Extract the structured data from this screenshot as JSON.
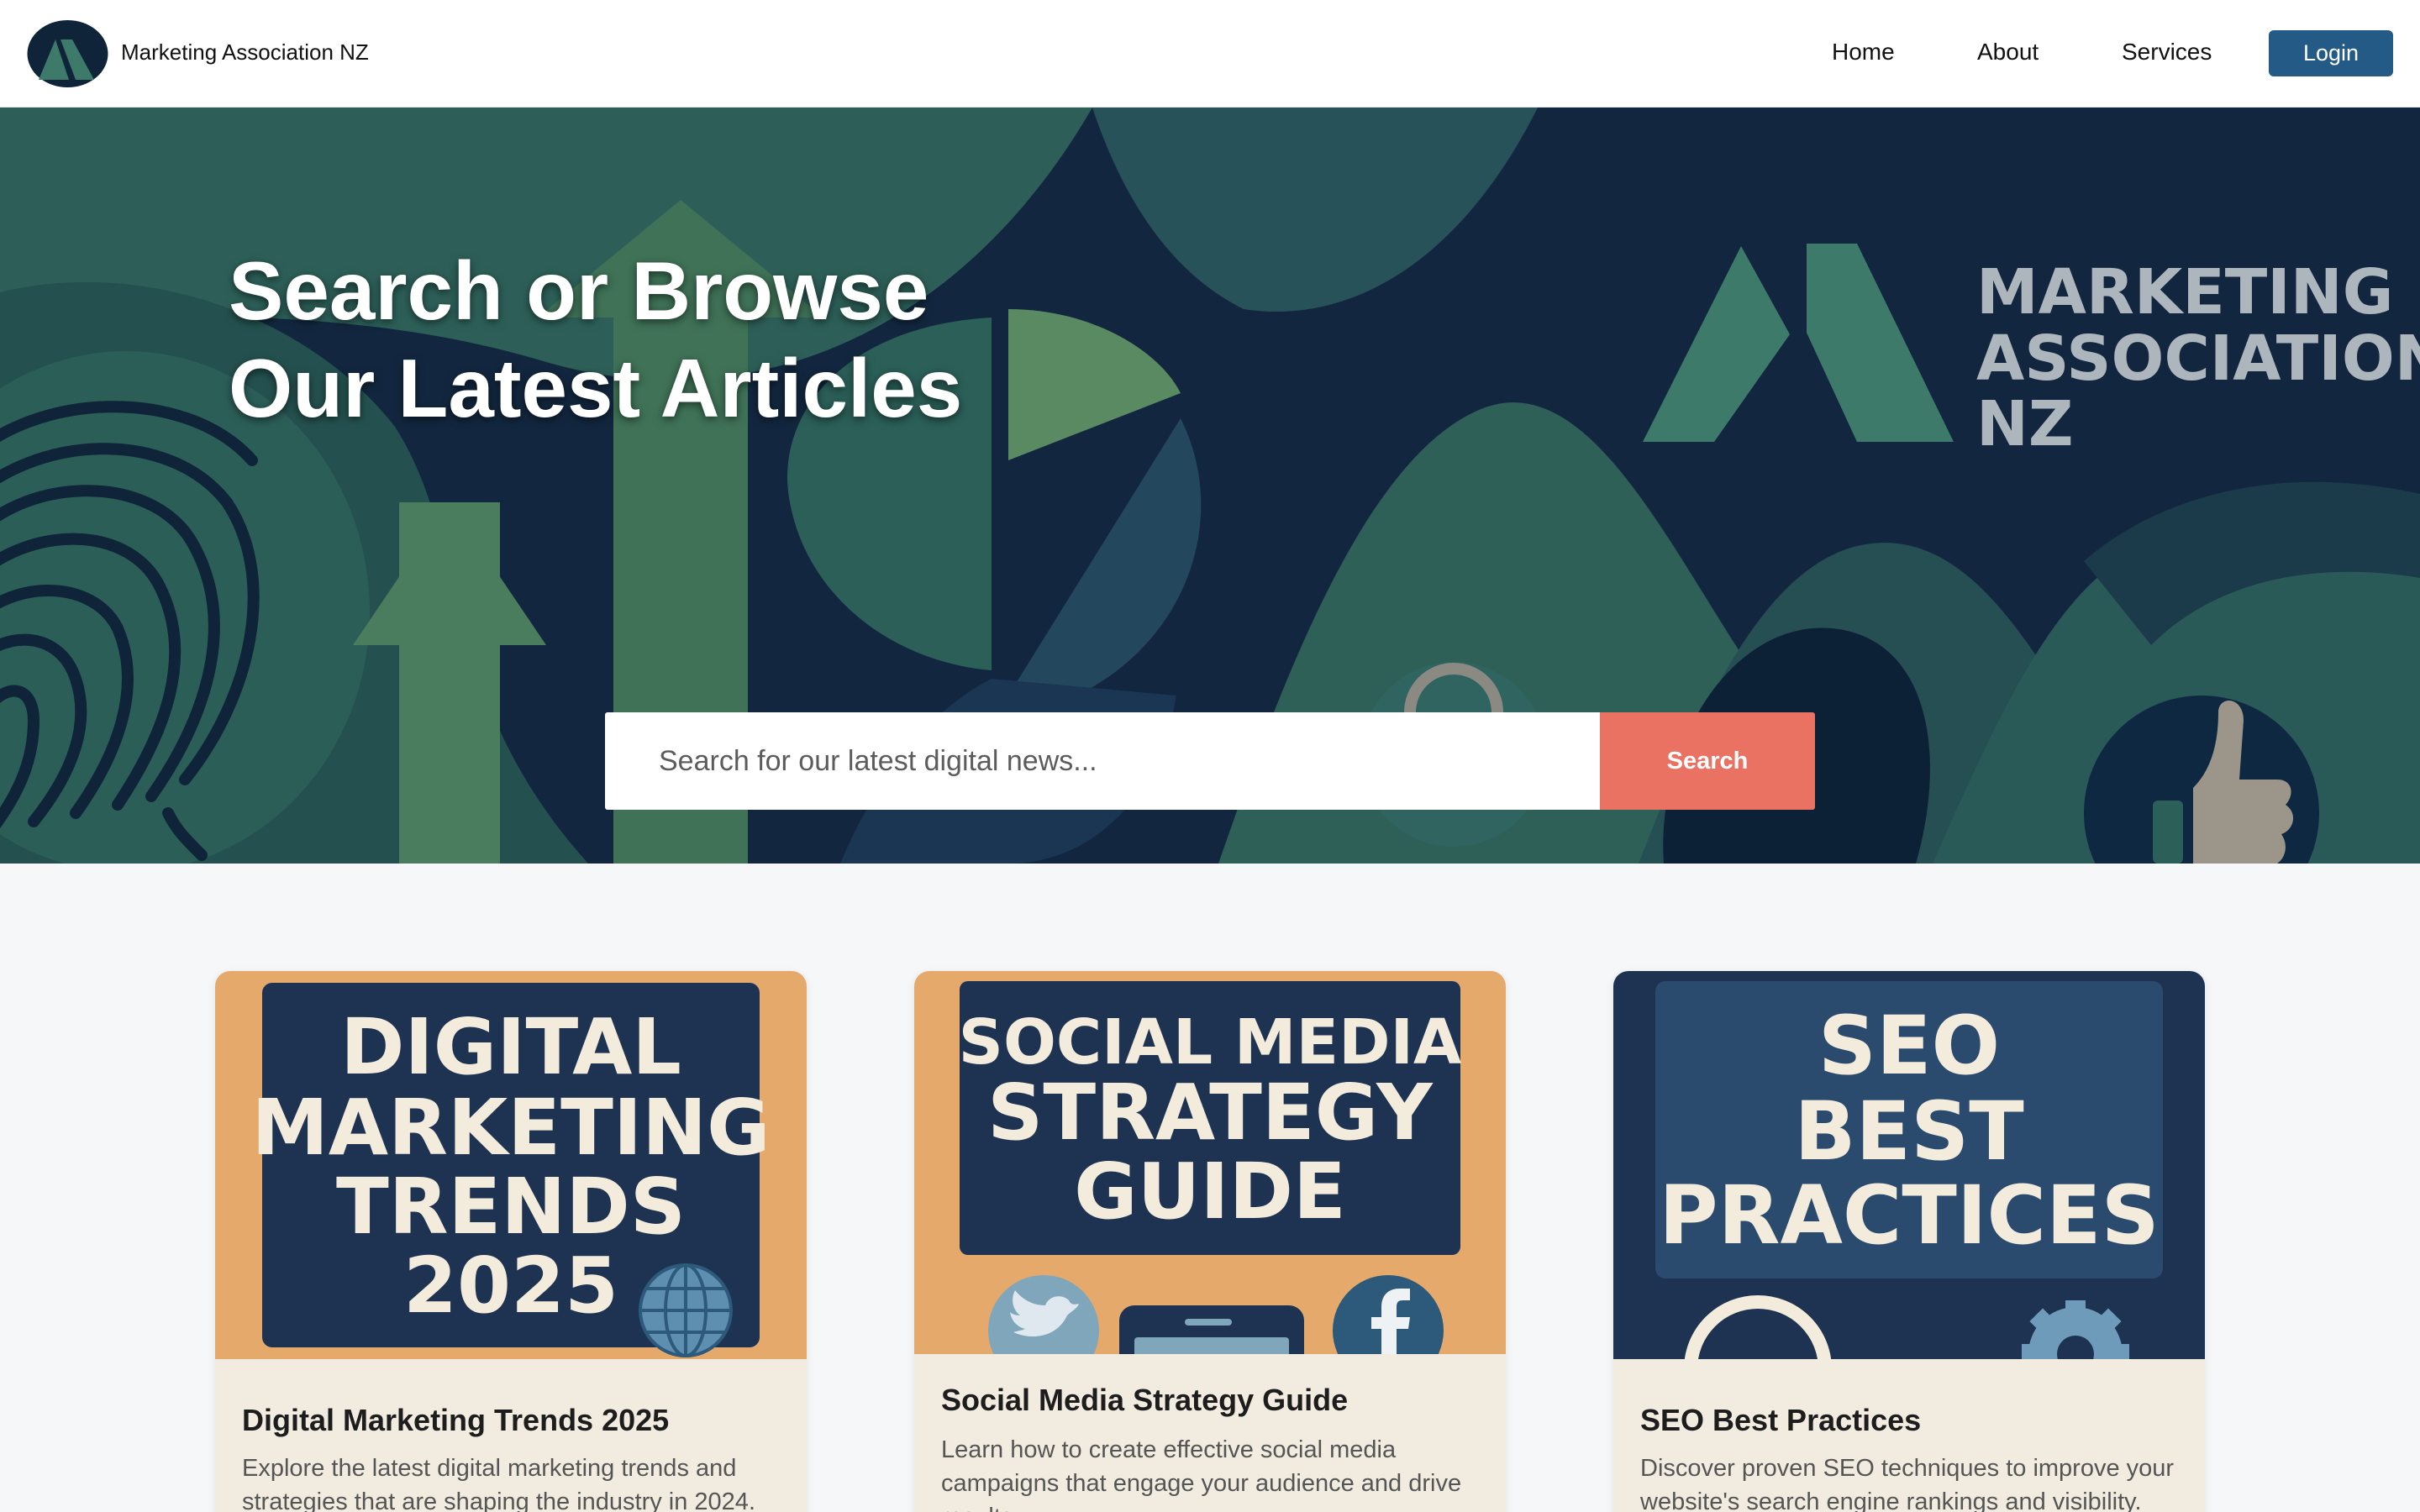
{
  "nav": {
    "brand": "Marketing Association NZ",
    "links": [
      "Home",
      "About",
      "Services"
    ],
    "login_label": "Login"
  },
  "hero": {
    "title_line1": "Search or Browse",
    "title_line2": "Our Latest Articles",
    "logo_text": [
      "MARKETING",
      "ASSOCIATION",
      "NZ"
    ],
    "search": {
      "placeholder": "Search for our latest digital news...",
      "button_label": "Search"
    }
  },
  "cards": [
    {
      "image_text": [
        "DIGITAL",
        "MARKETING",
        "TRENDS",
        "2025"
      ],
      "title": "Digital Marketing Trends 2025",
      "description": "Explore the latest digital marketing trends and strategies that are shaping the industry in 2024."
    },
    {
      "image_text": [
        "SOCIAL MEDIA",
        "STRATEGY",
        "GUIDE"
      ],
      "title": "Social Media Strategy Guide",
      "description": "Learn how to create effective social media campaigns that engage your audience and drive results."
    },
    {
      "image_text": [
        "SEO",
        "BEST",
        "PRACTICES"
      ],
      "title": "SEO Best Practices",
      "description": "Discover proven SEO techniques to improve your website's search engine rankings and visibility."
    }
  ],
  "colors": {
    "accent": "#ea7262",
    "nav_button": "#245a86",
    "hero_bg": "#12273f",
    "card_orange": "#e5aa6b",
    "card_navy": "#1e3352"
  }
}
